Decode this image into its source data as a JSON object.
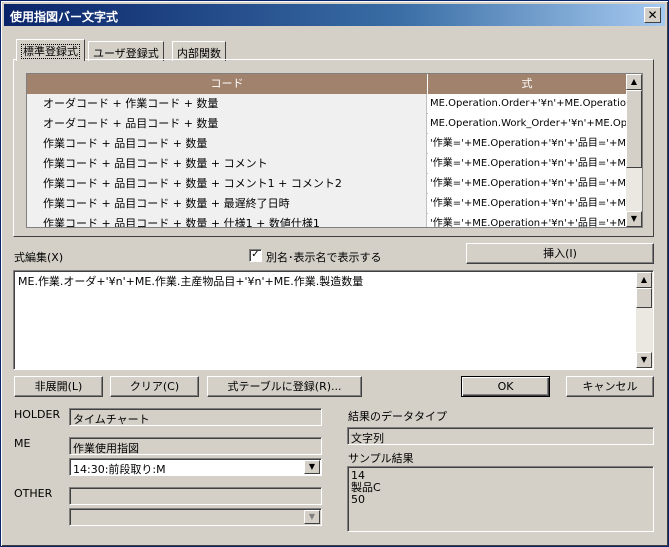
{
  "window": {
    "title": "使用指図バー文字式",
    "close": "✕"
  },
  "tabs": [
    {
      "label": "標準登録式"
    },
    {
      "label": "ユーザ登録式"
    },
    {
      "label": "内部関数"
    }
  ],
  "grid": {
    "headers": [
      "コード",
      "式"
    ],
    "rows": [
      [
        "オーダコード + 作業コード + 数量",
        "ME.Operation.Order+'¥n'+ME.Operation."
      ],
      [
        "オーダコード + 品目コード + 数量",
        "ME.Operation.Work_Order+'¥n'+ME.Ope"
      ],
      [
        "作業コード + 品目コード + 数量",
        "'作業='+ME.Operation+'¥n'+'品目='+ME."
      ],
      [
        "作業コード + 品目コード + 数量 + コメント",
        "'作業='+ME.Operation+'¥n'+'品目='+ME."
      ],
      [
        "作業コード + 品目コード + 数量 + コメント1 + コメント2",
        "'作業='+ME.Operation+'¥n'+'品目='+ME."
      ],
      [
        "作業コード + 品目コード + 数量 + 最遅終了日時",
        "'作業='+ME.Operation+'¥n'+'品目='+ME."
      ],
      [
        "作業コード + 品目コード + 数量 + 仕様1 + 数値仕様1",
        "'作業='+ME.Operation+'¥n'+'品目='+ME."
      ]
    ]
  },
  "editor": {
    "label": "式編集(X)",
    "checkbox_label": "別名･表示名で表示する",
    "checkbox_mark": "✓",
    "insert_button": "挿入(I)",
    "text": "ME.作業.オーダ+'¥n'+ME.作業.主産物品目+'¥n'+ME.作業.製造数量"
  },
  "buttons": {
    "collapse": "非展開(L)",
    "clear": "クリア(C)",
    "register": "式テーブルに登録(R)...",
    "ok": "OK",
    "cancel": "キャンセル"
  },
  "holder": {
    "label": "HOLDER",
    "value": "タイムチャート"
  },
  "me": {
    "label": "ME",
    "value": "作業使用指図",
    "combo_value": "14:30:前段取り:M"
  },
  "other": {
    "label": "OTHER",
    "value": "",
    "combo_value": ""
  },
  "result": {
    "type_label": "結果のデータタイプ",
    "type_value": "文字列",
    "sample_label": "サンプル結果",
    "sample_lines": [
      "14",
      "製品C",
      "50"
    ]
  },
  "icons": {
    "scroll_up": "▲",
    "scroll_down": "▼",
    "combo_down": "▼"
  }
}
